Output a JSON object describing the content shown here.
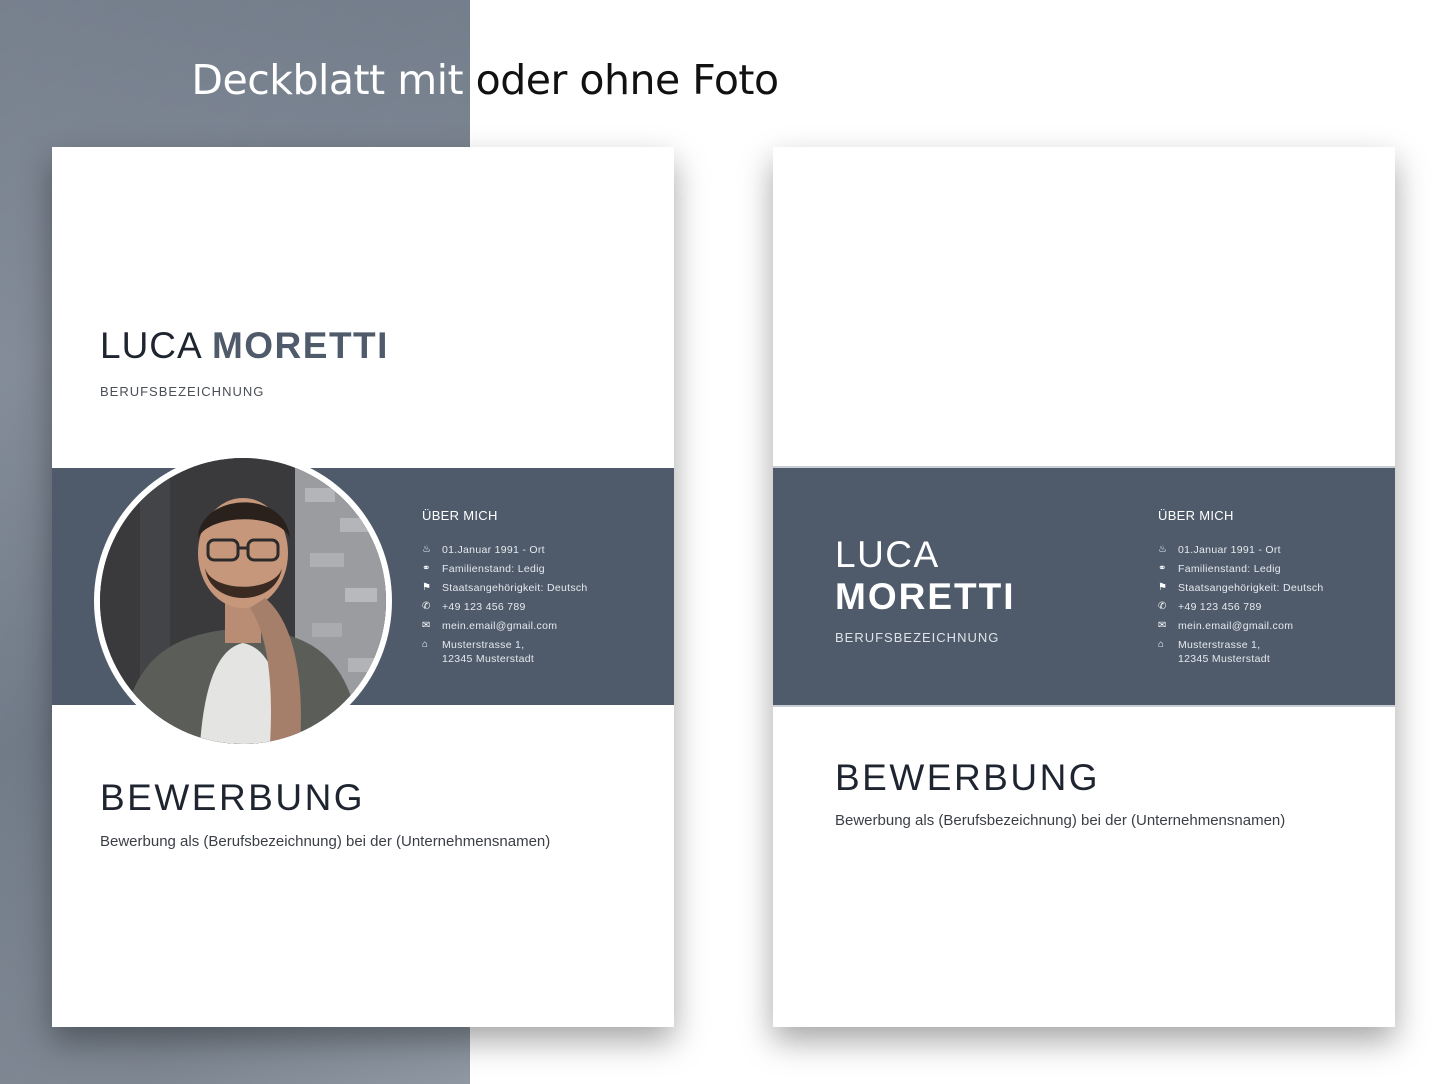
{
  "headline": {
    "part1": "Deckblatt mit ",
    "part2": "oder ohne Foto"
  },
  "colors": {
    "band": "#4f5b6b",
    "background_left": "#77818e",
    "text_dark": "#1f2530"
  },
  "cover_with_photo": {
    "first_name": "LUCA",
    "last_name": "MORETTI",
    "job_title": "BERUFSBEZEICHNUNG",
    "about_title": "ÜBER MICH",
    "info": [
      {
        "icon": "birthday-cake-icon",
        "text": "01.Januar 1991 - Ort"
      },
      {
        "icon": "rings-icon",
        "text": "Familienstand: Ledig"
      },
      {
        "icon": "flag-icon",
        "text": "Staatsangehörigkeit: Deutsch"
      },
      {
        "icon": "phone-icon",
        "text": "+49 123 456 789"
      },
      {
        "icon": "envelope-icon",
        "text": "mein.email@gmail.com"
      },
      {
        "icon": "home-icon",
        "text": "Musterstrasse 1,",
        "text2": "12345 Musterstadt"
      }
    ],
    "application_title": "BEWERBUNG",
    "application_subtitle": "Bewerbung als (Berufsbezeichnung) bei der (Unternehmensnamen)"
  },
  "cover_without_photo": {
    "first_name": "LUCA",
    "last_name": "MORETTI",
    "job_title": "BERUFSBEZEICHNUNG",
    "about_title": "ÜBER MICH",
    "info": [
      {
        "icon": "birthday-cake-icon",
        "text": "01.Januar 1991 - Ort"
      },
      {
        "icon": "rings-icon",
        "text": "Familienstand: Ledig"
      },
      {
        "icon": "flag-icon",
        "text": "Staatsangehörigkeit: Deutsch"
      },
      {
        "icon": "phone-icon",
        "text": "+49 123 456 789"
      },
      {
        "icon": "envelope-icon",
        "text": "mein.email@gmail.com"
      },
      {
        "icon": "home-icon",
        "text": "Musterstrasse 1,",
        "text2": "12345 Musterstadt"
      }
    ],
    "application_title": "BEWERBUNG",
    "application_subtitle": "Bewerbung als (Berufsbezeichnung) bei der (Unternehmensnamen)"
  }
}
